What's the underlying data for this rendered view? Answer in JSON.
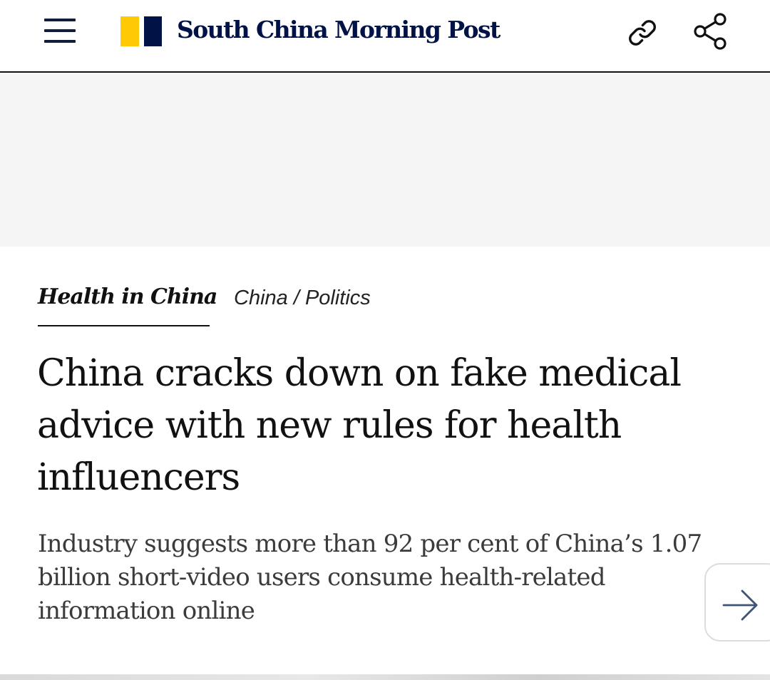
{
  "header": {
    "menu_icon": "hamburger-menu-icon",
    "logo_text": "South China Morning Post",
    "brand_colors": {
      "yellow": "#ffca05",
      "navy": "#001246"
    },
    "actions": [
      {
        "icon": "link-icon"
      },
      {
        "icon": "share-icon"
      }
    ]
  },
  "article": {
    "section_label": "Health in China",
    "breadcrumb": [
      "China",
      "Politics"
    ],
    "breadcrumb_separator": " / ",
    "headline": "China cracks down on fake medical advice with new rules for health influencers",
    "summary": "Industry suggests more than 92 per cent of China’s 1.07 billion short-video users consume health-related information online"
  },
  "next_button": {
    "icon": "arrow-right-icon"
  }
}
